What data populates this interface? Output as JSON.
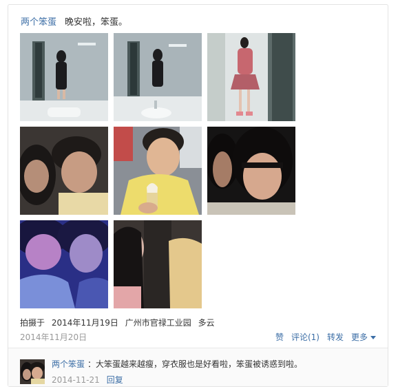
{
  "post": {
    "author": "两个笨蛋",
    "text": "晚安啦，笨蛋。",
    "photos": [
      {
        "icon": "photo-mirror-selfie-1"
      },
      {
        "icon": "photo-mirror-selfie-2"
      },
      {
        "icon": "photo-fullbody-selfie"
      },
      {
        "icon": "photo-couple-selfie-1"
      },
      {
        "icon": "photo-boy-icecream"
      },
      {
        "icon": "photo-couple-selfie-2"
      },
      {
        "icon": "photo-couple-selfie-purple"
      },
      {
        "icon": "photo-couple-selfie-dark"
      }
    ],
    "meta": {
      "prefix": "拍摄于",
      "date": "2014年11月19日",
      "location": "广州市官禄工业园",
      "weather": "多云"
    },
    "date": "2014年11月20日",
    "actions": {
      "like": "赞",
      "comment": "评论(1)",
      "share": "转发",
      "more": "更多"
    }
  },
  "comment": {
    "author": "两个笨蛋",
    "text": "：大笨蛋越来越瘦，穿衣服也是好看啦，笨蛋被诱惑到啦。",
    "date": "2014-11-21",
    "reply": "回复"
  },
  "colors": {
    "link": "#3c6ea6",
    "muted": "#999999",
    "border": "#e3e3e3"
  }
}
